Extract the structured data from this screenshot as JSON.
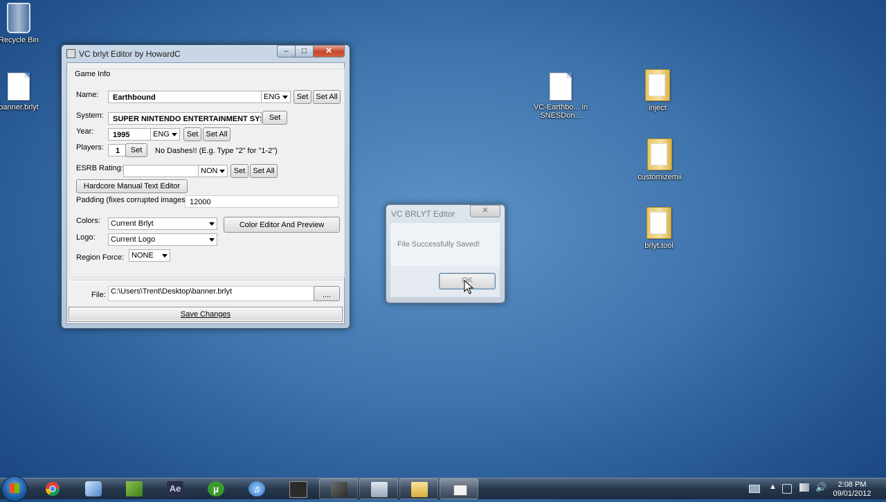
{
  "desktop": {
    "icons": [
      {
        "label": "Recycle Bin"
      },
      {
        "label": "banner.brlyt"
      },
      {
        "label": "VC-Earthbo... in SNESDon..."
      },
      {
        "label": "inject"
      },
      {
        "label": "customizemii"
      },
      {
        "label": "brlyt.tool"
      }
    ]
  },
  "window": {
    "title": "VC brlyt Editor by HowardC",
    "group_title": "Game Info",
    "name_label": "Name:",
    "name_value": "Earthbound",
    "name_lang": "ENG",
    "system_label": "System:",
    "system_value": "SUPER NINTENDO ENTERTAINMENT SYSTE",
    "year_label": "Year:",
    "year_value": "1995",
    "year_lang": "ENG",
    "players_label": "Players:",
    "players_value": "1",
    "players_hint": "No Dashes!! (E.g. Type \"2\" for \"1-2\")",
    "esrb_label": "ESRB Rating:",
    "esrb_value": "",
    "esrb_option": "NON",
    "manual_button": "Hardcore Manual Text Editor",
    "padding_label": "Padding (fixes corrupted images)",
    "padding_value": "12000",
    "colors_label": "Colors:",
    "colors_value": "Current Brlyt",
    "color_editor_button": "Color Editor And Preview",
    "logo_label": "Logo:",
    "logo_value": "Current Logo",
    "region_label": "Region Force:",
    "region_value": "NONE",
    "file_label": "File:",
    "file_value": "C:\\Users\\Trent\\Desktop\\banner.brlyt",
    "browse_button": "....",
    "save_button": "Save Changes",
    "set_label": "Set",
    "set_all_label": "Set All"
  },
  "dialog": {
    "title": "VC BRLYT Editor",
    "message": "File Successfully Saved!",
    "ok_label": "OK"
  },
  "taskbar": {
    "time": "2:08 PM",
    "date": "09/01/2012",
    "apps": [
      "chrome",
      "paint",
      "minecraft",
      "after-effects",
      "utorrent",
      "itunes",
      "terminal",
      "tool",
      "keyboard",
      "explorer",
      "window"
    ]
  }
}
